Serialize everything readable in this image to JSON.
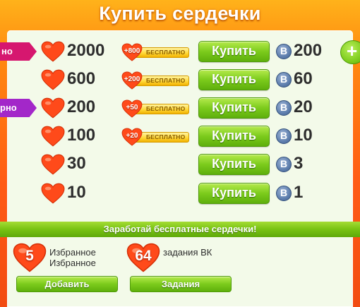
{
  "title": "Купить сердечки",
  "colors": {
    "background": "#ff6a14",
    "panel": "#f3fae9",
    "heart": "#ff4a1a",
    "button_green": "#7ccb1c",
    "vk_coin": "#5f7fae",
    "tag_pink": "#d6176f",
    "tag_purple": "#a327c9",
    "bonus_gold": "#ffd93a"
  },
  "side_tags": {
    "top": "но",
    "second": "рно"
  },
  "plus_button": {
    "label": "+"
  },
  "offers": [
    {
      "hearts": "2000",
      "bonus": "+800",
      "bonus_label": "БЕСПЛАТНО",
      "buy_label": "Купить",
      "currency": "В",
      "price": "200"
    },
    {
      "hearts": "600",
      "bonus": "+200",
      "bonus_label": "БЕСПЛАТНО",
      "buy_label": "Купить",
      "currency": "В",
      "price": "60"
    },
    {
      "hearts": "200",
      "bonus": "+50",
      "bonus_label": "БЕСПЛАТНО",
      "buy_label": "Купить",
      "currency": "В",
      "price": "20"
    },
    {
      "hearts": "100",
      "bonus": "+20",
      "bonus_label": "БЕСПЛАТНО",
      "buy_label": "Купить",
      "currency": "В",
      "price": "10"
    },
    {
      "hearts": "30",
      "buy_label": "Купить",
      "currency": "В",
      "price": "3"
    },
    {
      "hearts": "10",
      "buy_label": "Купить",
      "currency": "В",
      "price": "1"
    }
  ],
  "earn": {
    "banner": "Заработай бесплатные сердечки!",
    "favorites": {
      "reward": "5",
      "label_line1": "Избранное",
      "label_line2": "Избранное",
      "button": "Добавить"
    },
    "tasks": {
      "reward": "64",
      "label": "задания ВК",
      "button": "Задания"
    }
  }
}
